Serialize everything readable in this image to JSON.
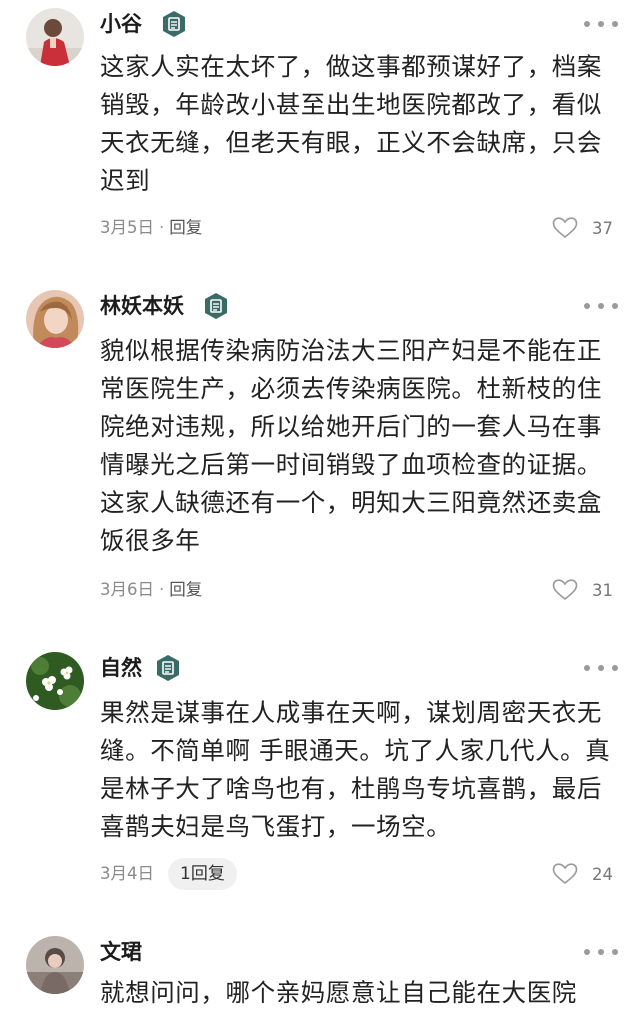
{
  "comments": [
    {
      "name": "小谷",
      "text": "这家人实在太坏了，做这事都预谋好了，档案销毁，年龄改小甚至出生地医院都改了，看似天衣无缝，但老天有眼，正义不会缺席，只会迟到",
      "date": "3月5日",
      "reply_label": "回复",
      "likes": "37",
      "avatar_color": "#c9303a"
    },
    {
      "name": "林妖本妖",
      "text": "貌似根据传染病防治法大三阳产妇是不能在正常医院生产，必须去传染病医院。杜新枝的住院绝对违规，所以给她开后门的一套人马在事情曝光之后第一时间销毁了血项检查的证据。这家人缺德还有一个，明知大三阳竟然还卖盒饭很多年",
      "date": "3月6日",
      "reply_label": "回复",
      "likes": "31",
      "avatar_color": "#d24a5a"
    },
    {
      "name": "自然",
      "text": "果然是谋事在人成事在天啊，谋划周密天衣无缝。不简单啊 手眼通天。坑了人家几代人。真是林子大了啥鸟也有，杜鹃鸟专坑喜鹊，最后喜鹊夫妇是鸟飞蛋打，一场空。",
      "date": "3月4日",
      "reply_label": "1回复",
      "likes": "24",
      "avatar_color": "#3d6b2e"
    },
    {
      "name": "文珺",
      "text": "就想问问，哪个亲妈愿意让自己能在大医院",
      "avatar_color": "#7a6a66"
    }
  ],
  "colors": {
    "badge": "#3b6b66",
    "meta_text": "#8a8a8a"
  }
}
